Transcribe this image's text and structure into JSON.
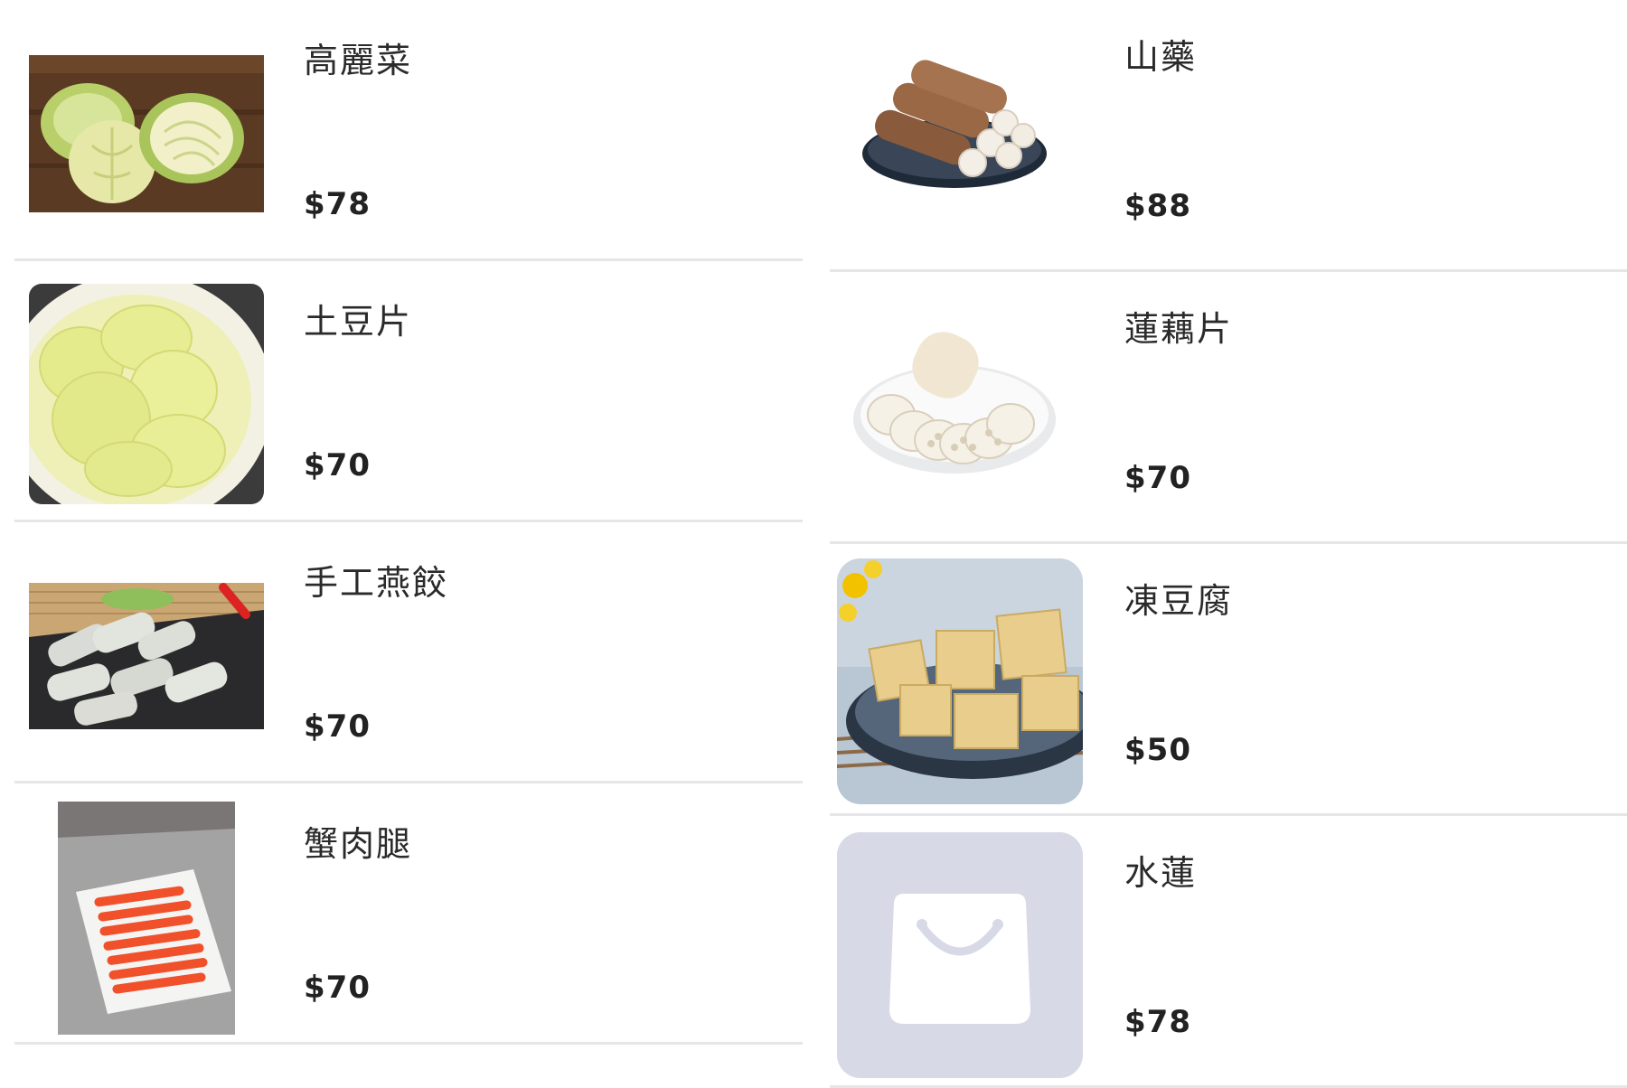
{
  "products_left": [
    {
      "name": "高麗菜",
      "price": "$78",
      "image": "cabbage-photo"
    },
    {
      "name": "土豆片",
      "price": "$70",
      "image": "potato-slices-photo"
    },
    {
      "name": "手工燕餃",
      "price": "$70",
      "image": "handmade-dumplings-photo"
    },
    {
      "name": "蟹肉腿",
      "price": "$70",
      "image": "crab-stick-photo"
    }
  ],
  "products_right": [
    {
      "name": "山藥",
      "price": "$88",
      "image": "yam-photo"
    },
    {
      "name": "蓮藕片",
      "price": "$70",
      "image": "lotus-root-slices-photo"
    },
    {
      "name": "凍豆腐",
      "price": "$50",
      "image": "frozen-tofu-photo"
    },
    {
      "name": "水蓮",
      "price": "$78",
      "image": "shopping-bag-placeholder-icon"
    }
  ]
}
